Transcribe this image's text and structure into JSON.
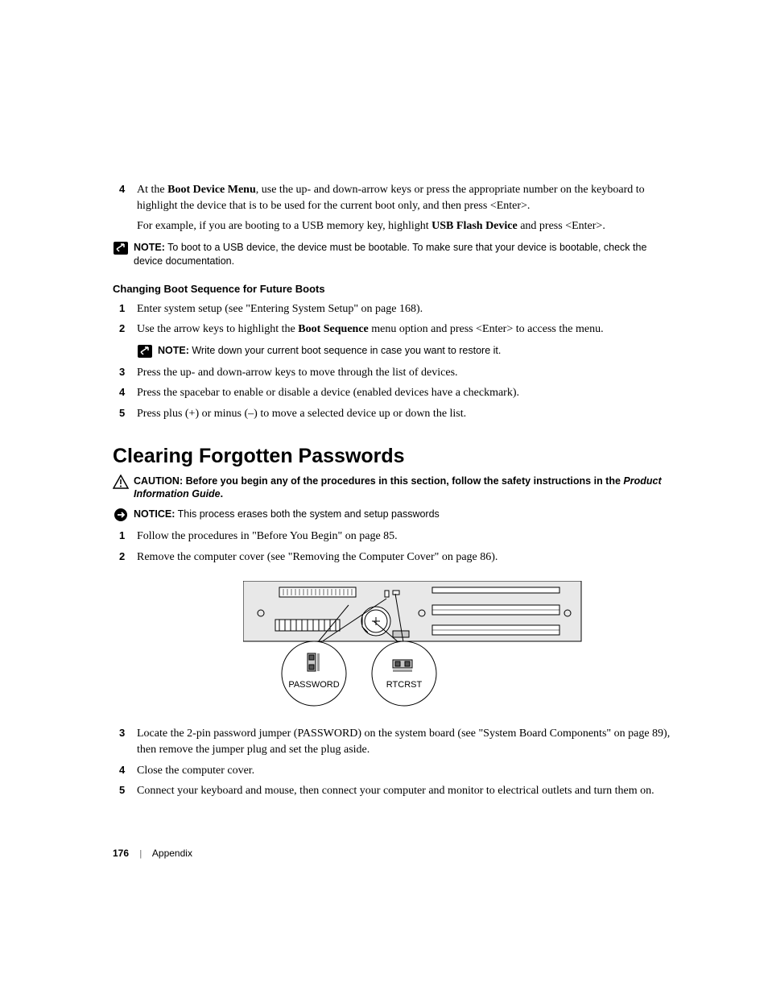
{
  "step4": {
    "num": "4",
    "text_a": "At the ",
    "bold_a": "Boot Device Menu",
    "text_b": ", use the up- and down-arrow keys or press the appropriate number on the keyboard to highlight the device that is to be used for the current boot only, and then press <Enter>.",
    "text_c": "For example, if you are booting to a USB memory key, highlight ",
    "bold_b": "USB Flash Device",
    "text_d": " and press <Enter>."
  },
  "note1": {
    "label": "NOTE:",
    "text": " To boot to a USB device, the device must be bootable. To make sure that your device is bootable, check the device documentation."
  },
  "subheading": "Changing Boot Sequence for Future Boots",
  "future_steps": {
    "s1": {
      "num": "1",
      "text": "Enter system setup (see \"Entering System Setup\" on page 168)."
    },
    "s2": {
      "num": "2",
      "text_a": "Use the arrow keys to highlight the ",
      "bold": "Boot Sequence",
      "text_b": " menu option and press <Enter> to access the menu."
    },
    "s3": {
      "num": "3",
      "text": "Press the up- and down-arrow keys to move through the list of devices."
    },
    "s4": {
      "num": "4",
      "text": "Press the spacebar to enable or disable a device (enabled devices have a checkmark)."
    },
    "s5": {
      "num": "5",
      "text": "Press plus (+) or minus (–) to move a selected device up or down the list."
    }
  },
  "note2": {
    "label": "NOTE:",
    "text": " Write down your current boot sequence in case you want to restore it."
  },
  "section_title": "Clearing Forgotten Passwords",
  "caution": {
    "label": "CAUTION:",
    "text_a": " Before you begin any of the procedures in this section, follow the safety instructions in the ",
    "italic": "Product Information Guide",
    "text_b": "."
  },
  "notice": {
    "label": "NOTICE:",
    "text": " This process erases both the system and setup passwords"
  },
  "clear_steps": {
    "s1": {
      "num": "1",
      "text": "Follow the procedures in \"Before You Begin\" on page 85."
    },
    "s2": {
      "num": "2",
      "text": "Remove the computer cover (see \"Removing the Computer Cover\" on page 86)."
    },
    "s3": {
      "num": "3",
      "text": "Locate the 2-pin password jumper (PASSWORD) on the system board (see \"System Board Components\" on page 89), then remove the jumper plug and set the plug aside."
    },
    "s4": {
      "num": "4",
      "text": "Close the computer cover."
    },
    "s5": {
      "num": "5",
      "text": "Connect your keyboard and mouse, then connect your computer and monitor to electrical outlets and turn them on."
    }
  },
  "diagram": {
    "label_left": "PASSWORD",
    "label_right": "RTCRST"
  },
  "footer": {
    "page": "176",
    "section": "Appendix"
  }
}
